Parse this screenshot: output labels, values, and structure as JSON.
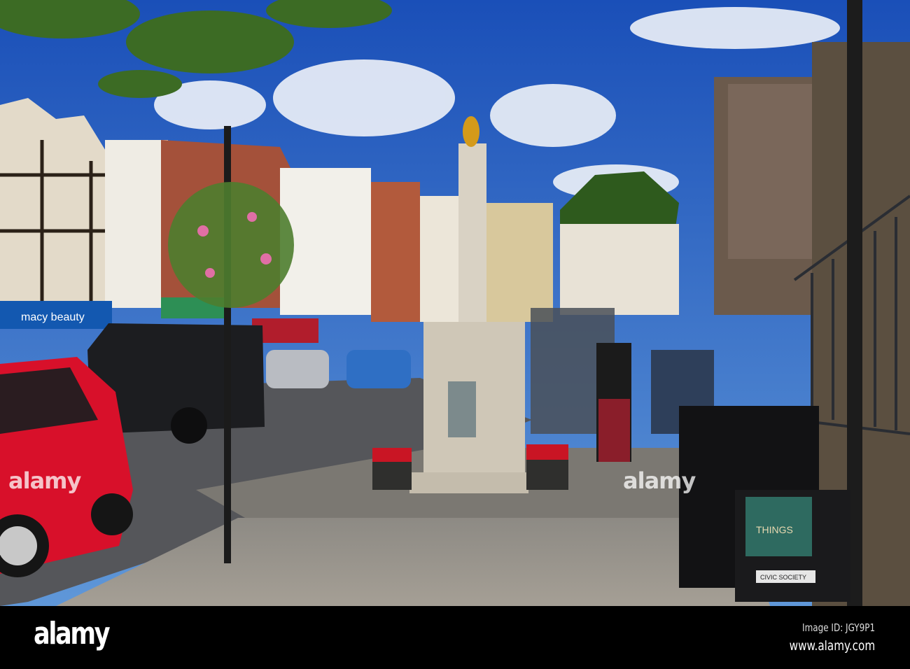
{
  "photo": {
    "shop_sign": "macy beauty",
    "bag_text": "THINGS",
    "bench_plaque": "CIVIC SOCIETY",
    "watermark": "alamy"
  },
  "footer": {
    "logo": "alamy",
    "image_id": "Image ID: JGY9P1",
    "website": "www.alamy.com"
  },
  "colors": {
    "sky": "#1f5fc4",
    "car": "#d8102a",
    "pavement": "#9a958c",
    "brick": "#a4513a"
  }
}
